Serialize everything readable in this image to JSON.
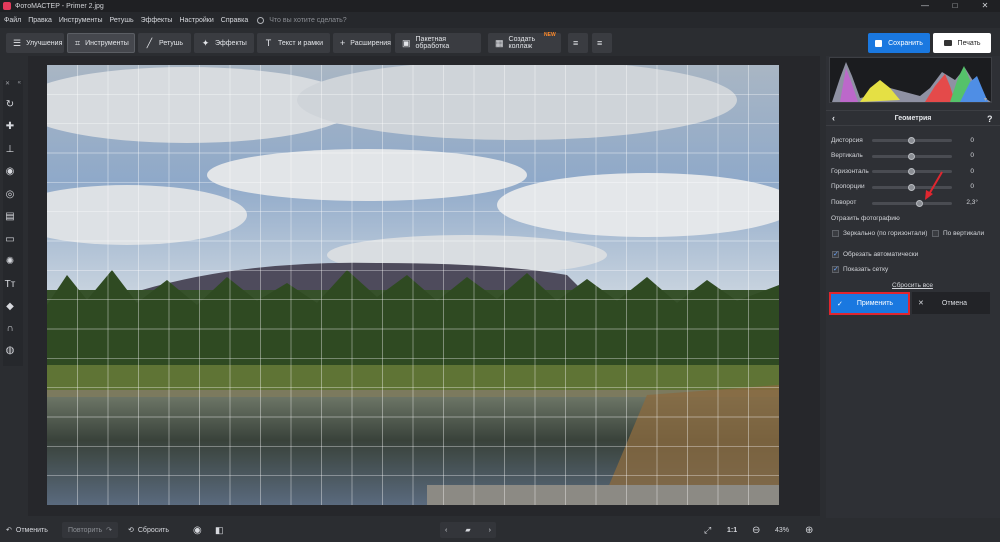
{
  "window": {
    "title": "ФотоМАСТЕР - Primer 2.jpg",
    "minimize": "—",
    "maximize": "□",
    "close": "✕"
  },
  "menu": {
    "items": [
      "Файл",
      "Правка",
      "Инструменты",
      "Ретушь",
      "Эффекты",
      "Настройки",
      "Справка"
    ],
    "search_placeholder": "Что вы хотите сделать?"
  },
  "toolbar": {
    "tabs": [
      {
        "label": "Улучшения",
        "icon": "sliders-icon"
      },
      {
        "label": "Инструменты",
        "icon": "crop-icon",
        "active": true
      },
      {
        "label": "Ретушь",
        "icon": "brush-icon"
      },
      {
        "label": "Эффекты",
        "icon": "sparkle-icon"
      },
      {
        "label": "Текст и рамки",
        "icon": "text-icon"
      },
      {
        "label": "Расширения",
        "icon": "plus-icon"
      }
    ],
    "batch_label": "Пакетная обработка",
    "collage_label": "Создать коллаж",
    "new_badge": "NEW",
    "save_label": "Сохранить",
    "print_label": "Печать",
    "accent_color": "#1a78e0"
  },
  "left_tools": [
    "crop-rotate-icon",
    "healing-icon",
    "stamp-icon",
    "target-icon",
    "gradient-icon",
    "vignette-icon",
    "light-icon",
    "text-icon",
    "fill-icon",
    "magnet-icon",
    "globe-icon"
  ],
  "panel": {
    "title": "Геометрия",
    "help": "?",
    "sliders": [
      {
        "label": "Дисторсия",
        "value": "0",
        "level": 0.5
      },
      {
        "label": "Вертикаль",
        "value": "0",
        "level": 0.5
      },
      {
        "label": "Горизонталь",
        "value": "0",
        "level": 0.5
      },
      {
        "label": "Пропорции",
        "value": "0",
        "level": 0.5
      },
      {
        "label": "Поворот",
        "value": "2,3°",
        "level": 0.6
      }
    ],
    "mirror_heading": "Отразить фотографию",
    "mirror_h": "Зеркально (по горизонтали)",
    "mirror_v": "По вертикали",
    "auto_crop": "Обрезать автоматически",
    "show_grid": "Показать сетку",
    "reset_all": "Сбросить все",
    "apply_label": "Применить",
    "cancel_label": "Отмена",
    "highlight_color": "#e0262f"
  },
  "bottom": {
    "undo": "Отменить",
    "redo": "Повторить",
    "reset": "Сбросить",
    "ratio": "1:1",
    "zoom": "43%"
  }
}
